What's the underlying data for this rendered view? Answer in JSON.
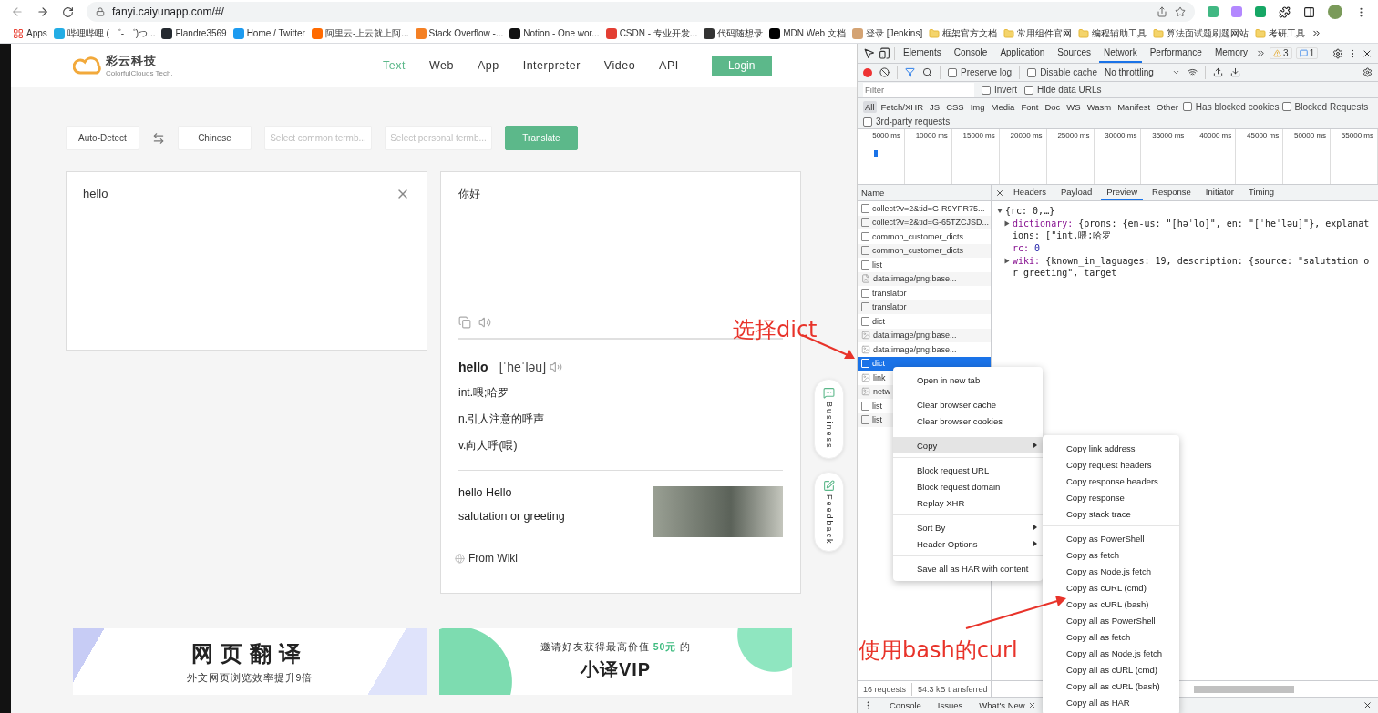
{
  "browser": {
    "url": "fanyi.caiyunapp.com/#/",
    "bookmarks": [
      {
        "label": "Apps",
        "kind": "apps"
      },
      {
        "label": "哔哩哔哩 ( ゜- ゜)つ...",
        "kind": "site",
        "color": "#23ade5"
      },
      {
        "label": "Flandre3569",
        "kind": "site",
        "color": "#24292f"
      },
      {
        "label": "Home / Twitter",
        "kind": "site",
        "color": "#1d9bf0"
      },
      {
        "label": "阿里云-上云就上阿...",
        "kind": "site",
        "color": "#ff6a00"
      },
      {
        "label": "Stack Overflow -...",
        "kind": "site",
        "color": "#f48024"
      },
      {
        "label": "Notion - One wor...",
        "kind": "site",
        "color": "#111111"
      },
      {
        "label": "CSDN - 专业开发...",
        "kind": "site",
        "color": "#e33e33"
      },
      {
        "label": "代码随想录",
        "kind": "site",
        "color": "#333333"
      },
      {
        "label": "MDN Web 文档",
        "kind": "site",
        "color": "#000000"
      },
      {
        "label": "登录 [Jenkins]",
        "kind": "site",
        "color": "#d4a373"
      },
      {
        "label": "框架官方文档",
        "kind": "folder"
      },
      {
        "label": "常用组件官网",
        "kind": "folder"
      },
      {
        "label": "编程辅助工具",
        "kind": "folder"
      },
      {
        "label": "算法面试题刷题网站",
        "kind": "folder"
      },
      {
        "label": "考研工具",
        "kind": "folder"
      }
    ]
  },
  "site": {
    "logo_title": "彩云科技",
    "logo_subtitle": "ColorfulClouds Tech.",
    "nav": [
      {
        "label": "Text",
        "selected": true
      },
      {
        "label": "Web",
        "selected": false
      },
      {
        "label": "App",
        "selected": false
      },
      {
        "label": "Interpreter",
        "selected": false
      },
      {
        "label": "Video",
        "selected": false
      },
      {
        "label": "API",
        "selected": false
      }
    ],
    "login": "Login",
    "toolbar": {
      "source_language": "Auto-Detect",
      "target_language": "Chinese",
      "common_termbase_placeholder": "Select common termb...",
      "personal_termbase_placeholder": "Select personal termb...",
      "translate": "Translate"
    },
    "source_text": "hello",
    "result": {
      "translation": "你好",
      "word": "hello",
      "phonetic": "[ˈheˈləu]",
      "definitions": [
        "int.喂;哈罗",
        "n.引人注意的呼声",
        "v.向人呼(喂)"
      ],
      "wiki_title": "hello Hello",
      "wiki_description": "salutation or greeting",
      "wiki_source": "From Wiki"
    },
    "side_buttons": [
      "Business",
      "Feedback"
    ],
    "banners": [
      {
        "kind": "web",
        "title": "网页翻译",
        "subtitle": "外文网页浏览效率提升9倍"
      },
      {
        "kind": "vip",
        "headline": "邀请好友获得最高价值 **50元** 的",
        "title": "小译VIP"
      }
    ]
  },
  "devtools": {
    "tabs": [
      {
        "label": "Elements",
        "selected": false
      },
      {
        "label": "Console",
        "selected": false
      },
      {
        "label": "Application",
        "selected": false
      },
      {
        "label": "Sources",
        "selected": false
      },
      {
        "label": "Network",
        "selected": true
      },
      {
        "label": "Performance",
        "selected": false
      },
      {
        "label": "Memory",
        "selected": false
      }
    ],
    "warnings": "3",
    "messages": "1",
    "preserve_log": {
      "label": "Preserve log",
      "checked": false
    },
    "disable_cache": {
      "label": "Disable cache",
      "checked": false
    },
    "throttling": "No throttling",
    "filter_placeholder": "Filter",
    "invert": {
      "label": "Invert",
      "checked": false
    },
    "hide_data_urls": {
      "label": "Hide data URLs",
      "checked": false
    },
    "type_filters": [
      {
        "label": "All",
        "selected": true
      },
      {
        "label": "Fetch/XHR",
        "selected": false
      },
      {
        "label": "JS",
        "selected": false
      },
      {
        "label": "CSS",
        "selected": false
      },
      {
        "label": "Img",
        "selected": false
      },
      {
        "label": "Media",
        "selected": false
      },
      {
        "label": "Font",
        "selected": false
      },
      {
        "label": "Doc",
        "selected": false
      },
      {
        "label": "WS",
        "selected": false
      },
      {
        "label": "Wasm",
        "selected": false
      },
      {
        "label": "Manifest",
        "selected": false
      },
      {
        "label": "Other",
        "selected": false
      }
    ],
    "has_blocked_cookies": {
      "label": "Has blocked cookies",
      "checked": false
    },
    "blocked_requests": {
      "label": "Blocked Requests",
      "checked": false
    },
    "third_party": {
      "label": "3rd-party requests",
      "checked": false
    },
    "timeline_ticks": [
      "5000 ms",
      "10000 ms",
      "15000 ms",
      "20000 ms",
      "25000 ms",
      "30000 ms",
      "35000 ms",
      "40000 ms",
      "45000 ms",
      "50000 ms",
      "55000 ms"
    ],
    "name_header": "Name",
    "requests": [
      {
        "name": "collect?v=2&tid=G-R9YPR75...",
        "kind": "document",
        "selected": false
      },
      {
        "name": "collect?v=2&tid=G-65TZCJSD...",
        "kind": "document",
        "selected": false
      },
      {
        "name": "common_customer_dicts",
        "kind": "document",
        "selected": false
      },
      {
        "name": "common_customer_dicts",
        "kind": "document",
        "selected": false
      },
      {
        "name": "list",
        "kind": "document",
        "selected": false
      },
      {
        "name": "data:image/png;base...",
        "kind": "broken",
        "selected": false
      },
      {
        "name": "translator",
        "kind": "document",
        "selected": false
      },
      {
        "name": "translator",
        "kind": "document",
        "selected": false
      },
      {
        "name": "dict",
        "kind": "document",
        "selected": false
      },
      {
        "name": "data:image/png;base...",
        "kind": "image",
        "selected": false
      },
      {
        "name": "data:image/png;base...",
        "kind": "image",
        "selected": false
      },
      {
        "name": "dict",
        "kind": "document",
        "selected": true
      },
      {
        "name": "link_",
        "kind": "image",
        "selected": false
      },
      {
        "name": "netw",
        "kind": "image",
        "selected": false
      },
      {
        "name": "list",
        "kind": "document",
        "selected": false
      },
      {
        "name": "list",
        "kind": "document",
        "selected": false
      }
    ],
    "detail_tabs": [
      {
        "label": "Headers",
        "selected": false
      },
      {
        "label": "Payload",
        "selected": false
      },
      {
        "label": "Preview",
        "selected": true
      },
      {
        "label": "Response",
        "selected": false
      },
      {
        "label": "Initiator",
        "selected": false
      },
      {
        "label": "Timing",
        "selected": false
      }
    ],
    "preview": [
      {
        "kind": "root",
        "text": "{rc: 0,…}",
        "expanded": true
      },
      {
        "kind": "object",
        "key": "dictionary:",
        "text": "{prons: {en-us: \"[həˈlo]\", en: \"[ˈheˈləu]\"}, explanations: [\"int.喂;哈罗",
        "expanded": false
      },
      {
        "kind": "value",
        "key": "rc:",
        "text": "0"
      },
      {
        "kind": "object",
        "key": "wiki:",
        "text": "{known_in_laguages: 19, description: {source: \"salutation or greeting\", target",
        "expanded": false
      }
    ],
    "status_requests": "16 requests",
    "status_transferred": "54.3 kB transferred",
    "drawer_tabs": [
      {
        "label": "Console",
        "closable": false
      },
      {
        "label": "Issues",
        "closable": false
      },
      {
        "label": "What's New",
        "closable": true
      }
    ]
  },
  "context_menu": {
    "groups": [
      [
        {
          "label": "Open in new tab",
          "submenu": false,
          "selected": false
        }
      ],
      [
        {
          "label": "Clear browser cache",
          "submenu": false,
          "selected": false
        },
        {
          "label": "Clear browser cookies",
          "submenu": false,
          "selected": false
        }
      ],
      [
        {
          "label": "Copy",
          "submenu": true,
          "selected": true
        }
      ],
      [
        {
          "label": "Block request URL",
          "submenu": false,
          "selected": false
        },
        {
          "label": "Block request domain",
          "submenu": false,
          "selected": false
        },
        {
          "label": "Replay XHR",
          "submenu": false,
          "selected": false
        }
      ],
      [
        {
          "label": "Sort By",
          "submenu": true,
          "selected": false
        },
        {
          "label": "Header Options",
          "submenu": true,
          "selected": false
        }
      ],
      [
        {
          "label": "Save all as HAR with content",
          "submenu": false,
          "selected": false
        }
      ]
    ]
  },
  "copy_submenu": {
    "groups": [
      [
        "Copy link address",
        "Copy request headers",
        "Copy response headers",
        "Copy response",
        "Copy stack trace"
      ],
      [
        "Copy as PowerShell",
        "Copy as fetch",
        "Copy as Node.js fetch",
        "Copy as cURL (cmd)",
        "Copy as cURL (bash)",
        "Copy all as PowerShell",
        "Copy all as fetch",
        "Copy all as Node.js fetch",
        "Copy all as cURL (cmd)",
        "Copy all as cURL (bash)",
        "Copy all as HAR"
      ]
    ]
  },
  "annotations": [
    "选择dict",
    "使用bash的curl"
  ]
}
